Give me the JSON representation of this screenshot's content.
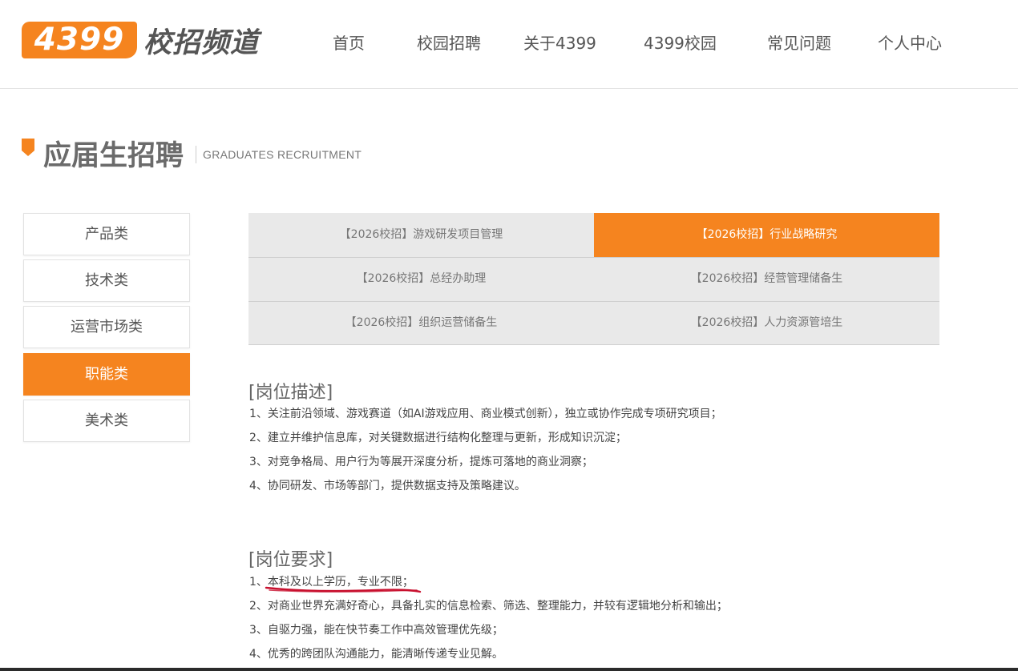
{
  "header": {
    "logo_number": "4399",
    "logo_text": "校招频道",
    "nav": [
      "首页",
      "校园招聘",
      "关于4399",
      "4399校园",
      "常见问题",
      "个人中心"
    ]
  },
  "section": {
    "title": "应届生招聘",
    "subtitle": "GRADUATES RECRUITMENT"
  },
  "sidebar": {
    "items": [
      {
        "label": "产品类"
      },
      {
        "label": "技术类"
      },
      {
        "label": "运营市场类"
      },
      {
        "label": "职能类"
      },
      {
        "label": "美术类"
      }
    ],
    "active": "职能类"
  },
  "jobs": [
    {
      "label": "【2026校招】游戏研发项目管理"
    },
    {
      "label": "【2026校招】行业战略研究"
    },
    {
      "label": "【2026校招】总经办助理"
    },
    {
      "label": "【2026校招】经营管理储备生"
    },
    {
      "label": "【2026校招】组织运营储备生"
    },
    {
      "label": "【2026校招】人力资源管培生"
    }
  ],
  "active_job": "【2026校招】行业战略研究",
  "description": {
    "heading": "[岗位描述]",
    "items": [
      "1、关注前沿领域、游戏赛道（如AI游戏应用、商业模式创新），独立或协作完成专项研究项目；",
      "2、建立并维护信息库，对关键数据进行结构化整理与更新，形成知识沉淀；",
      "3、对竞争格局、用户行为等展开深度分析，提炼可落地的商业洞察；",
      "4、协同研发、市场等部门，提供数据支持及策略建议。"
    ]
  },
  "requirements": {
    "heading": "[岗位要求]",
    "items": [
      "1、本科及以上学历，专业不限；",
      "2、对商业世界充满好奇心，具备扎实的信息检索、筛选、整理能力，并较有逻辑地分析和输出；",
      "3、自驱力强，能在快节奏工作中高效管理优先级；",
      "4、优秀的跨团队沟通能力，能清晰传递专业见解。"
    ]
  },
  "colors": {
    "accent": "#f5841f",
    "annotation": "#c8102e"
  }
}
